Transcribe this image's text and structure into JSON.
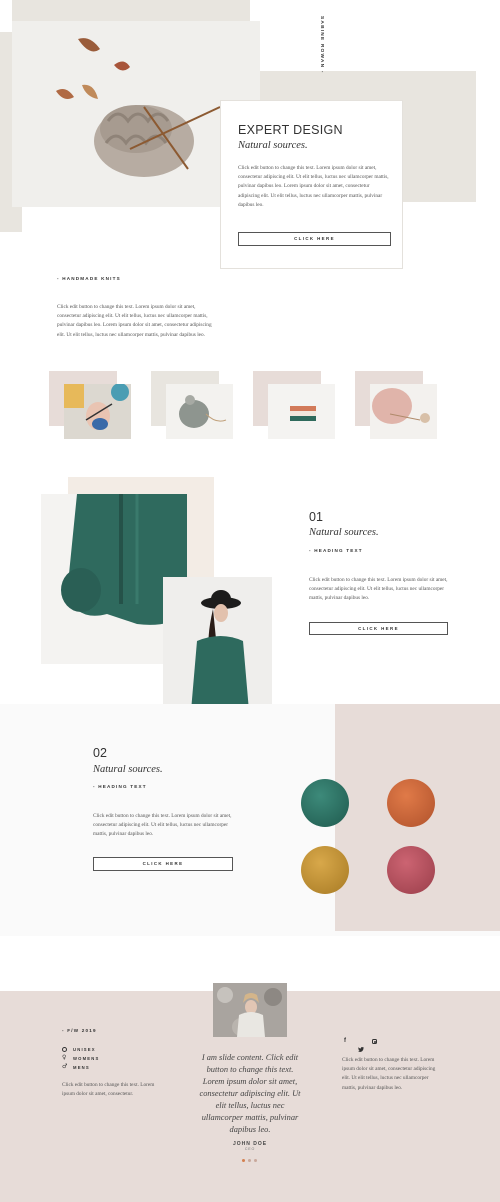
{
  "hero": {
    "vertical_text": "SABINE ROWAN -",
    "title": "EXPERT DESIGN",
    "subtitle": "Natural sources.",
    "body": "Click edit button to change this text. Lorem ipsum dolor sit amet, consectetur adipiscing elit. Ut elit tellus, luctus nec ullamcorper mattis, pulvinar dapibus leo. Lorem ipsum dolor sit amet, consectetur adipiscing elit. Ut elit tellus, luctus nec ullamcorper mattis, pulvinar dapibus leo.",
    "button": "CLICK HERE"
  },
  "handmade": {
    "heading": "- HANDMADE KNITS",
    "body": "Click edit button to change this text. Lorem ipsum dolor sit amet, consectetur adipiscing elit. Ut elit tellus, luctus nec ullamcorper mattis, pulvinar dapibus leo. Lorem ipsum dolor sit amet, consectetur adipiscing elit. Ut elit tellus, luctus nec ullamcorper mattis, pulvinar dapibus leo."
  },
  "feature1": {
    "number": "01",
    "subtitle": "Natural sources.",
    "heading": "- HEADING TEXT",
    "body": "Click edit button to change this text. Lorem ipsum dolor sit amet, consectetur adipiscing elit. Ut elit tellus, luctus nec ullamcorper mattis, pulvinar dapibus leo.",
    "button": "CLICK HERE"
  },
  "feature2": {
    "number": "02",
    "subtitle": "Natural sources.",
    "heading": "- HEADING TEXT",
    "body": "Click edit button to change this text. Lorem ipsum dolor sit amet, consectetur adipiscing elit. Ut elit tellus, luctus nec ullamcorper mattis, pulvinar dapibus leo.",
    "button": "CLICK HERE"
  },
  "footer": {
    "season": "- F/W 2019",
    "categories": [
      "UNISEX",
      "WOMENS",
      "MENS"
    ],
    "left_body": "Click edit button to change this text. Lorem ipsum dolor sit amet, consectetur.",
    "quote": "I am slide content. Click edit button to change this text. Lorem ipsum dolor sit amet, consectetur adipiscing elit. Ut elit tellus, luctus nec ullamcorper mattis, pulvinar dapibus leo.",
    "author": "JOHN DOE",
    "author_role": "CEO",
    "right_body": "Click edit button to change this text. Lorem ipsum dolor sit amet, consectetur adipiscing elit. Ut elit tellus, luctus nec ullamcorper mattis, pulvinar dapibus leo.",
    "social_icons": [
      "facebook-icon",
      "twitter-icon",
      "instagram-icon"
    ]
  },
  "colors": {
    "beige": "#e8e5df",
    "pink": "#e7dcd8",
    "teal": "#2e7064",
    "orange": "#c4633a",
    "mustard": "#c19433",
    "rose": "#b5505c",
    "accent_dot": "#d4804f"
  }
}
